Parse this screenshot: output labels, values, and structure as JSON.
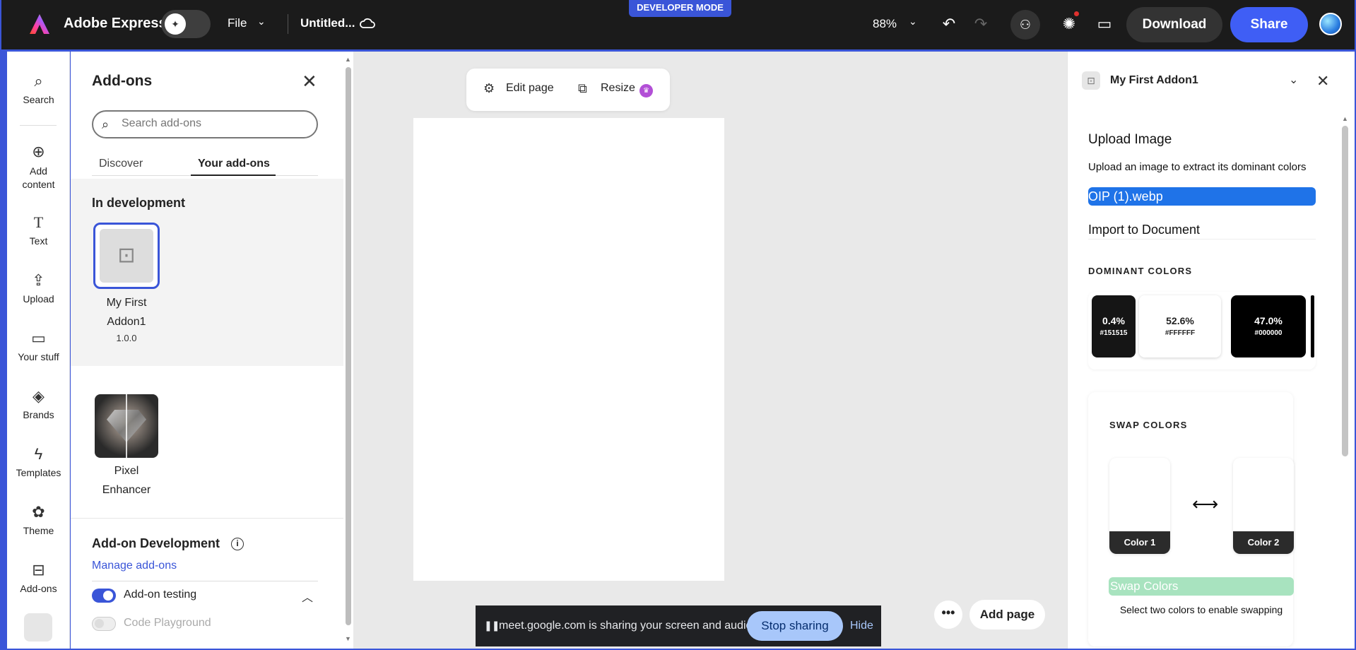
{
  "header": {
    "dev_mode_label": "DEVELOPER MODE",
    "brand": "Adobe Express",
    "file_menu": "File",
    "doc_title": "Untitled...",
    "zoom": "88%",
    "download_label": "Download",
    "share_label": "Share"
  },
  "rail": {
    "items": [
      {
        "label": "Search",
        "icon": "search-icon"
      },
      {
        "label": "Add content",
        "icon": "plus-circle-icon"
      },
      {
        "label": "Text",
        "icon": "text-icon"
      },
      {
        "label": "Upload",
        "icon": "upload-icon"
      },
      {
        "label": "Your stuff",
        "icon": "folder-icon"
      },
      {
        "label": "Brands",
        "icon": "brand-icon"
      },
      {
        "label": "Templates",
        "icon": "templates-icon"
      },
      {
        "label": "Theme",
        "icon": "palette-icon"
      },
      {
        "label": "Add-ons",
        "icon": "addons-icon"
      }
    ],
    "active": "Add-ons"
  },
  "addons_panel": {
    "title": "Add-ons",
    "search_placeholder": "Search add-ons",
    "tabs": [
      "Discover",
      "Your add-ons"
    ],
    "active_tab": "Your add-ons",
    "in_development_title": "In development",
    "dev_addon": {
      "name_line1": "My First",
      "name_line2": "Addon1",
      "version": "1.0.0"
    },
    "installed_addon": {
      "name_line1": "Pixel",
      "name_line2": "Enhancer"
    },
    "dev_section_title": "Add-on Development",
    "manage_link": "Manage add-ons",
    "addon_testing_label": "Add-on testing",
    "addon_testing_on": true,
    "code_playground_label": "Code Playground",
    "code_playground_on": false
  },
  "canvas": {
    "edit_page_label": "Edit page",
    "resize_label": "Resize",
    "add_page_label": "Add page",
    "more_label": "•••"
  },
  "screen_share": {
    "message": "meet.google.com is sharing your screen and audio.",
    "stop_label": "Stop sharing",
    "hide_label": "Hide"
  },
  "right_panel": {
    "title": "My First Addon1",
    "upload_title": "Upload Image",
    "upload_subtitle": "Upload an image to extract its dominant colors",
    "file_name": "OIP (1).webp",
    "import_label": "Import to Document",
    "dominant_colors_label": "DOMINANT COLORS",
    "dominant_colors": [
      {
        "percent": "0.4%",
        "hex": "#151515",
        "color": "#151515",
        "text_color": "#ffffff"
      },
      {
        "percent": "52.6%",
        "hex": "#FFFFFF",
        "color": "#FFFFFF",
        "text_color": "#222222"
      },
      {
        "percent": "47.0%",
        "hex": "#000000",
        "color": "#000000",
        "text_color": "#ffffff"
      }
    ],
    "swap_colors_label": "SWAP COLORS",
    "color1_label": "Color 1",
    "color2_label": "Color 2",
    "swap_arrow": "⟷",
    "swap_button_label": "Swap Colors",
    "swap_hint": "Select two colors to enable swapping"
  },
  "colors": {
    "accent": "#3a55d8",
    "share_button": "#3f5ef5",
    "file_field": "#1f73e8",
    "swap_button_disabled": "#a8e3bf"
  }
}
